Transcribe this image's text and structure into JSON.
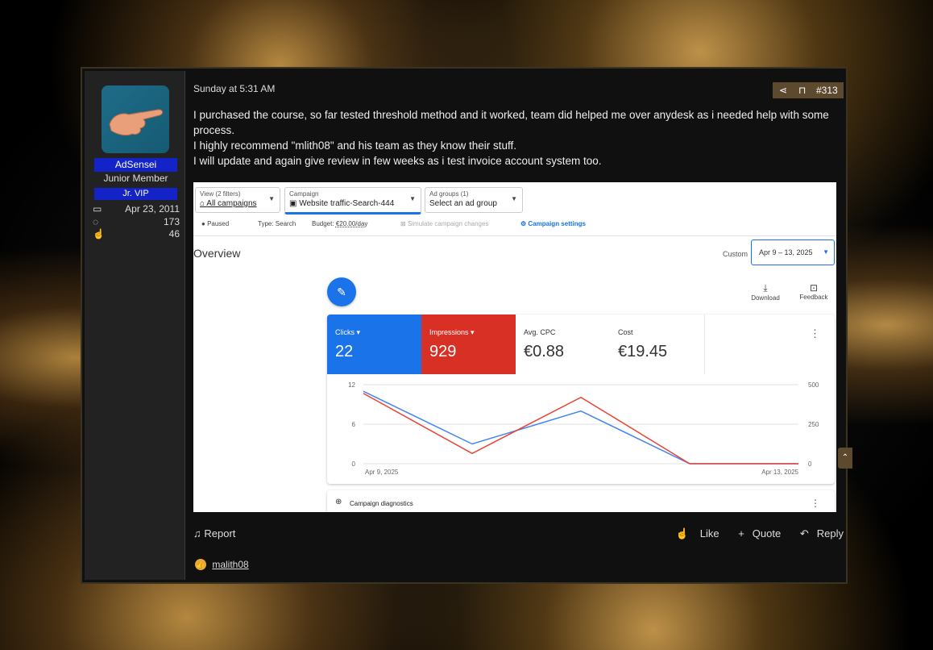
{
  "post": {
    "date": "Sunday at 5:31 AM",
    "number": "#313",
    "share_icon": "share-icon",
    "bookmark_icon": "bookmark-icon",
    "lines": [
      "I purchased the course, so far tested threshold method and it worked, team did helped me over anydesk as i needed help with some process.",
      "I highly recommend \"mlith08\" and his team as they know their stuff.",
      "I will update and again give review in few weeks as i test invoice account system too."
    ]
  },
  "user": {
    "name": "AdSensei",
    "title": "Junior Member",
    "badge": "Jr. VIP",
    "joined": "Apr 23, 2011",
    "messages": "173",
    "reactions": "46",
    "name_color": "#1323c8"
  },
  "ads": {
    "view_label": "View (2 filters)",
    "view_value": "All campaigns",
    "campaign_label": "Campaign",
    "campaign_value": "Website traffic-Search-444",
    "adgroups_label": "Ad groups (1)",
    "adgroups_value": "Select an ad group",
    "status": "Paused",
    "type": "Type: Search",
    "budget_prefix": "Budget: ",
    "budget_value": "€20.00/day",
    "simulate": "Simulate campaign changes",
    "settings": "Campaign settings",
    "overview": "Overview",
    "custom": "Custom",
    "date_range": "Apr 9 – 13, 2025",
    "download": "Download",
    "feedback": "Feedback",
    "diagnostics": "Campaign diagnostics",
    "metrics": [
      {
        "label": "Clicks",
        "value": "22",
        "bg": "#1a73e8"
      },
      {
        "label": "Impressions",
        "value": "929",
        "bg": "#d93025"
      },
      {
        "label": "Avg. CPC",
        "value": "€0.88",
        "bg": "#ffffff"
      },
      {
        "label": "Cost",
        "value": "€19.45",
        "bg": "#ffffff"
      }
    ]
  },
  "chart_data": {
    "type": "line",
    "x": [
      "Apr 9, 2025",
      "Apr 10, 2025",
      "Apr 11, 2025",
      "Apr 12, 2025",
      "Apr 13, 2025"
    ],
    "x_tick_labels": [
      "Apr 9, 2025",
      "Apr 13, 2025"
    ],
    "series": [
      {
        "name": "Clicks",
        "axis": "left",
        "color": "#4285f4",
        "values": [
          11,
          3,
          8,
          0,
          0
        ]
      },
      {
        "name": "Impressions",
        "axis": "right",
        "color": "#ea4335",
        "values": [
          445,
          65,
          420,
          0,
          0
        ]
      }
    ],
    "y_left": {
      "ticks": [
        "0",
        "6",
        "12"
      ],
      "ylim": [
        0,
        12
      ]
    },
    "y_right": {
      "ticks": [
        "0",
        "250",
        "500"
      ],
      "ylim": [
        0,
        500
      ]
    },
    "grid": true
  },
  "footer": {
    "report": "Report",
    "like": "Like",
    "quote": "Quote",
    "reply": "Reply",
    "reactor": "malith08"
  }
}
